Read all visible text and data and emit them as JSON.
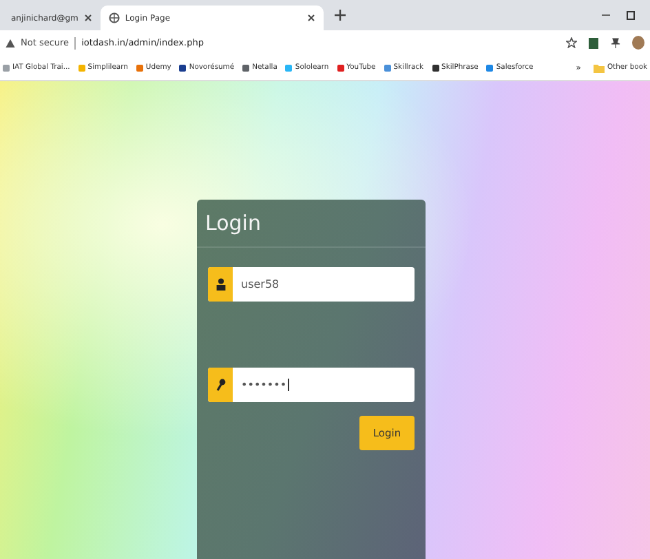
{
  "tabs": [
    {
      "title": "anjinichard@gm",
      "selected": false
    },
    {
      "title": "Login Page",
      "selected": true
    }
  ],
  "address_bar": {
    "security": "Not secure",
    "url": "iotdash.in/admin/index.php"
  },
  "bookmarks": [
    {
      "label": "IAT Global Trai...",
      "color": "#9aa0a6"
    },
    {
      "label": "Simplilearn",
      "color": "#f4b400"
    },
    {
      "label": "Udemy",
      "color": "#e8710a"
    },
    {
      "label": "Novorésumé",
      "color": "#1a3d8f"
    },
    {
      "label": "Netalla",
      "color": "#5f6368"
    },
    {
      "label": "Sololearn",
      "color": "#29b6f6"
    },
    {
      "label": "YouTube",
      "color": "#e02020"
    },
    {
      "label": "Skillrack",
      "color": "#4a90d9"
    },
    {
      "label": "SkilPhrase",
      "color": "#303030"
    },
    {
      "label": "Salesforce",
      "color": "#1e88e5"
    }
  ],
  "bookmarks_more": "»",
  "other_bookmarks": "Other book",
  "login": {
    "title": "Login",
    "username": "user58",
    "password": "•••••••",
    "button": "Login"
  }
}
